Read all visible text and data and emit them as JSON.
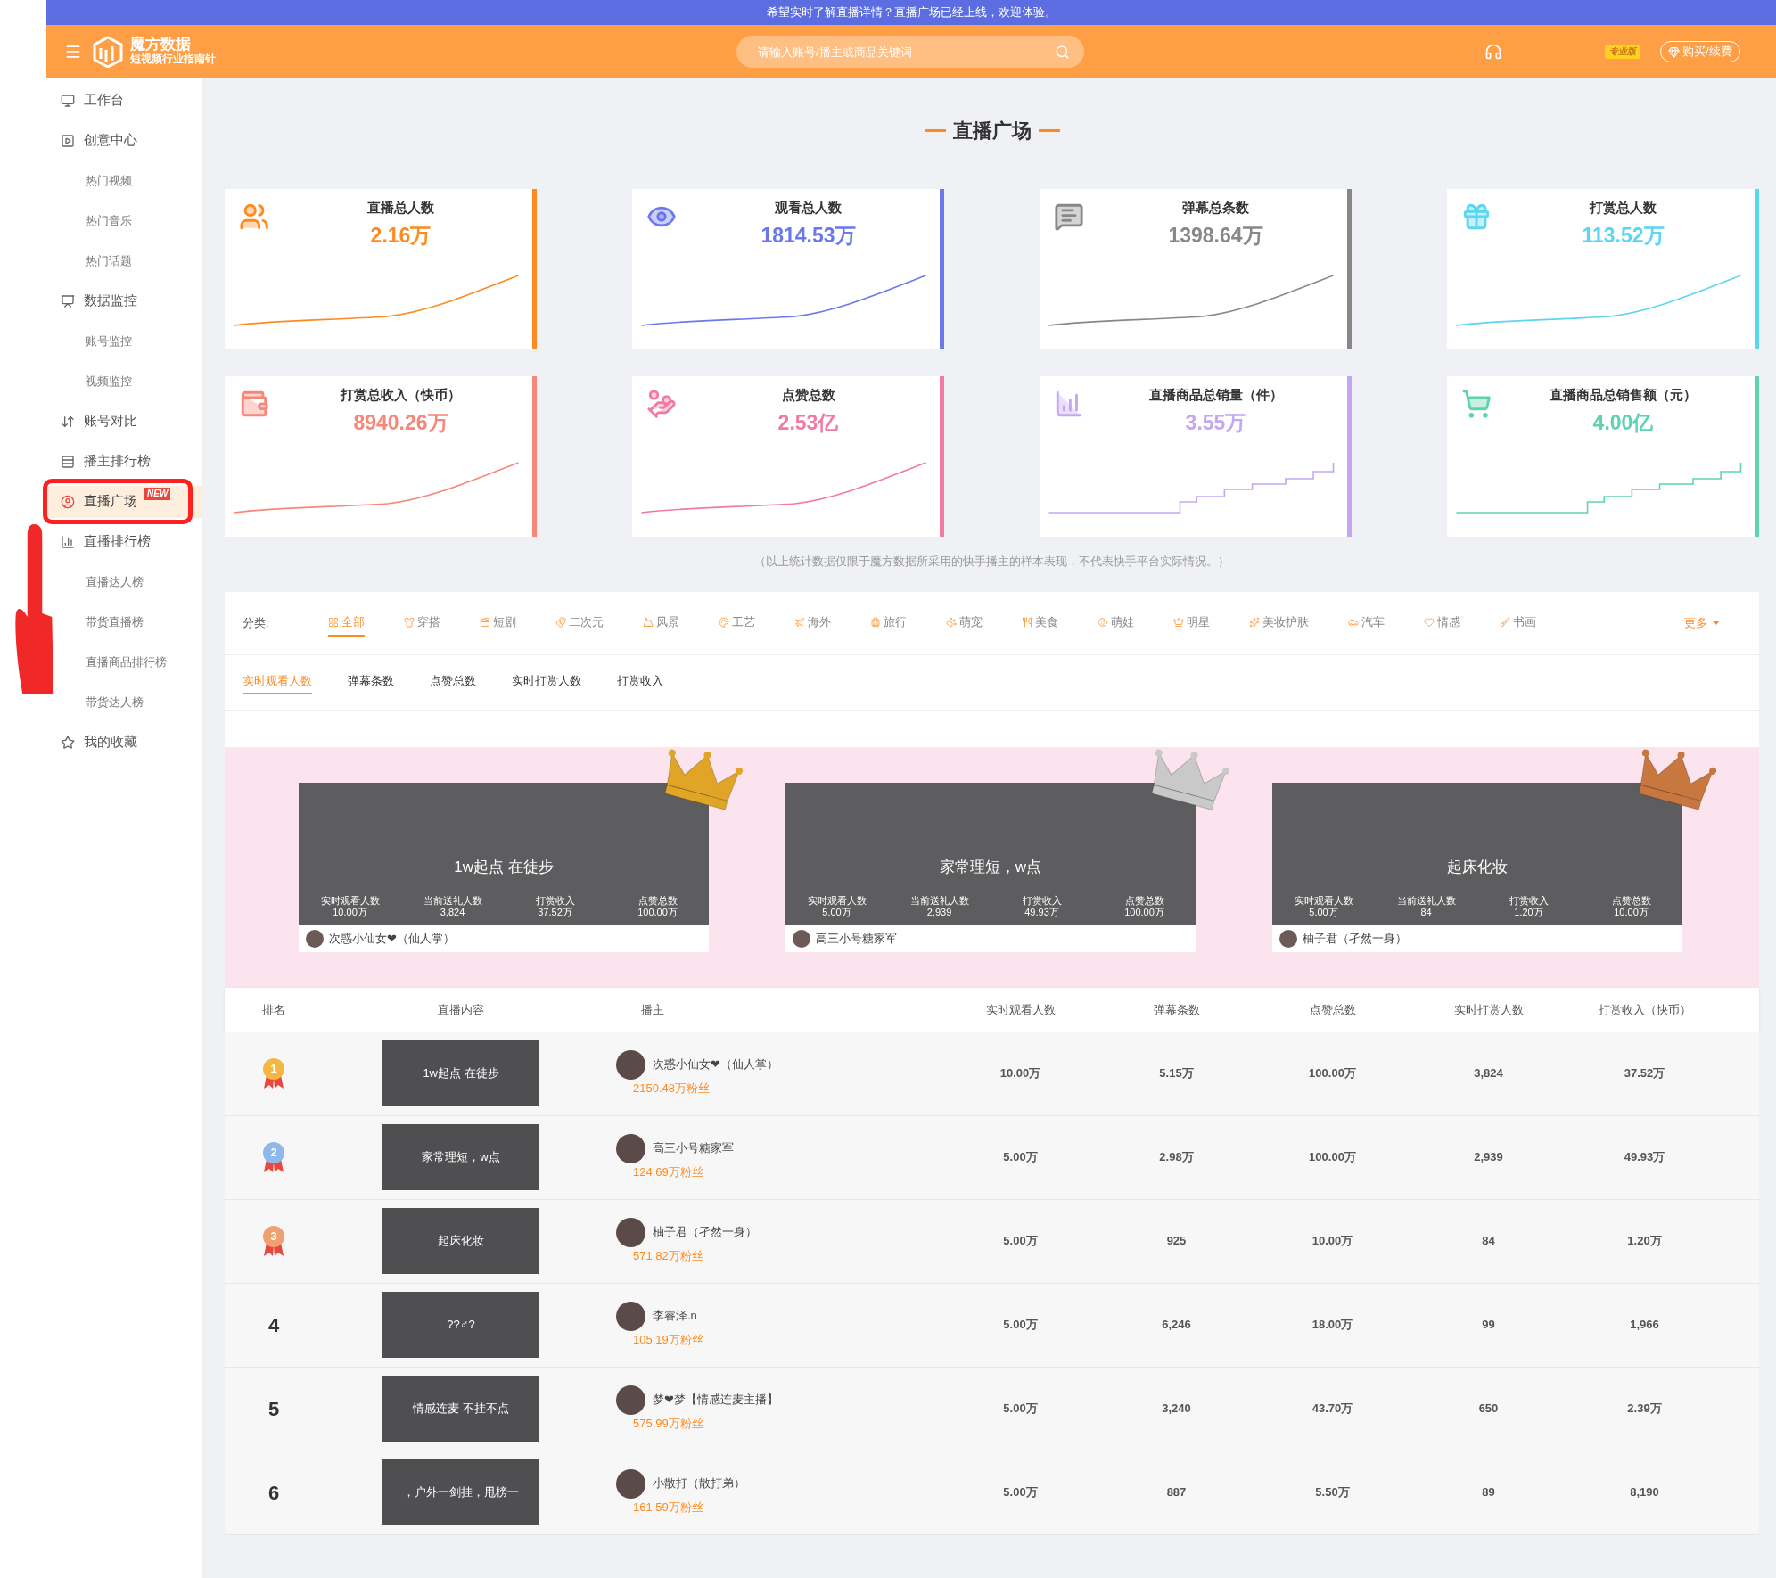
{
  "banner": {
    "text": "希望实时了解直播详情？直播广场已经上线，欢迎体验。"
  },
  "header": {
    "brand": "魔方数据",
    "tagline": "短视频行业指南针",
    "search": {
      "placeholder": "请输入账号/播主或商品关键词"
    },
    "plan_badge": "专业版",
    "buy_button": "购买/续费"
  },
  "sidebar": {
    "items": [
      {
        "label": "工作台",
        "selected": false
      },
      {
        "label": "创意中心",
        "selected": false,
        "children": [
          {
            "label": "热门视频",
            "selected": false
          },
          {
            "label": "热门音乐",
            "selected": false
          },
          {
            "label": "热门话题",
            "selected": false
          }
        ]
      },
      {
        "label": "数据监控",
        "selected": false,
        "children": [
          {
            "label": "账号监控",
            "selected": false
          },
          {
            "label": "视频监控",
            "selected": false
          }
        ]
      },
      {
        "label": "账号对比",
        "selected": false
      },
      {
        "label": "播主排行榜",
        "selected": false
      },
      {
        "label": "直播广场",
        "selected": true,
        "badge": "NEW"
      },
      {
        "label": "直播排行榜",
        "selected": false,
        "children": [
          {
            "label": "直播达人榜",
            "selected": false
          },
          {
            "label": "带货直播榜",
            "selected": false
          },
          {
            "label": "直播商品排行榜",
            "selected": false
          },
          {
            "label": "带货达人榜",
            "selected": false
          }
        ]
      },
      {
        "label": "我的收藏",
        "selected": false
      }
    ]
  },
  "page_title": "直播广场",
  "stat_cards": [
    {
      "title": "直播总人数",
      "value": "2.16万",
      "color": "#ff8a1f",
      "kind": "curve"
    },
    {
      "title": "观看总人数",
      "value": "1814.53万",
      "color": "#6b78ec",
      "kind": "curve"
    },
    {
      "title": "弹幕总条数",
      "value": "1398.64万",
      "color": "#888888",
      "kind": "curve"
    },
    {
      "title": "打赏总人数",
      "value": "113.52万",
      "color": "#5ad6f0",
      "kind": "curve"
    },
    {
      "title": "打赏总收入（快币）",
      "value": "8940.26万",
      "color": "#f7877a",
      "kind": "curve"
    },
    {
      "title": "点赞总数",
      "value": "2.53亿",
      "color": "#f27aa2",
      "kind": "curve"
    },
    {
      "title": "直播商品总销量（件）",
      "value": "3.55万",
      "color": "#c3a6f4",
      "kind": "step"
    },
    {
      "title": "直播商品总销售额（元）",
      "value": "4.00亿",
      "color": "#5fd3b0",
      "kind": "step"
    }
  ],
  "note": "（以上统计数据仅限于魔方数据所采用的快手播主的样本表现，不代表快手平台实际情况。）",
  "categories": {
    "label": "分类:",
    "more": "更多",
    "items": [
      {
        "label": "全部",
        "selected": true
      },
      {
        "label": "穿搭",
        "selected": false
      },
      {
        "label": "短剧",
        "selected": false
      },
      {
        "label": "二次元",
        "selected": false
      },
      {
        "label": "风景",
        "selected": false
      },
      {
        "label": "工艺",
        "selected": false
      },
      {
        "label": "海外",
        "selected": false
      },
      {
        "label": "旅行",
        "selected": false
      },
      {
        "label": "萌宠",
        "selected": false
      },
      {
        "label": "美食",
        "selected": false
      },
      {
        "label": "萌娃",
        "selected": false
      },
      {
        "label": "明星",
        "selected": false
      },
      {
        "label": "美妆护肤",
        "selected": false
      },
      {
        "label": "汽车",
        "selected": false
      },
      {
        "label": "情感",
        "selected": false
      },
      {
        "label": "书画",
        "selected": false
      }
    ]
  },
  "metric_tabs": [
    {
      "label": "实时观看人数",
      "selected": true
    },
    {
      "label": "弹幕条数",
      "selected": false
    },
    {
      "label": "点赞总数",
      "selected": false
    },
    {
      "label": "实时打赏人数",
      "selected": false
    },
    {
      "label": "打赏收入",
      "selected": false
    }
  ],
  "podium": [
    {
      "title": "1w起点 在徒步",
      "color": "#e0a526",
      "anchor": "次惑小仙女❤（仙人掌）",
      "stats": [
        {
          "label": "实时观看人数",
          "value": "10.00万"
        },
        {
          "label": "当前送礼人数",
          "value": "3,824"
        },
        {
          "label": "打赏收入",
          "value": "37.52万"
        },
        {
          "label": "点赞总数",
          "value": "100.00万"
        }
      ]
    },
    {
      "title": "家常理短，w点",
      "color": "#c9c9c9",
      "anchor": "高三小号糖家军",
      "stats": [
        {
          "label": "实时观看人数",
          "value": "5.00万"
        },
        {
          "label": "当前送礼人数",
          "value": "2,939"
        },
        {
          "label": "打赏收入",
          "value": "49.93万"
        },
        {
          "label": "点赞总数",
          "value": "100.00万"
        }
      ]
    },
    {
      "title": "起床化妆",
      "color": "#c8773f",
      "anchor": "柚子君（孑然一身）",
      "stats": [
        {
          "label": "实时观看人数",
          "value": "5.00万"
        },
        {
          "label": "当前送礼人数",
          "value": "84"
        },
        {
          "label": "打赏收入",
          "value": "1.20万"
        },
        {
          "label": "点赞总数",
          "value": "10.00万"
        }
      ]
    }
  ],
  "table": {
    "columns": [
      "排名",
      "直播内容",
      "播主",
      "实时观看人数",
      "弹幕条数",
      "点赞总数",
      "实时打赏人数",
      "打赏收入（快币）"
    ],
    "rows": [
      {
        "kind": "medal",
        "color": "#f5b642",
        "cells": [
          "1",
          "1w起点 在徒步",
          {
            "name": "次惑小仙女❤（仙人掌）",
            "fans": "2150.48万粉丝"
          },
          "10.00万",
          "5.15万",
          "100.00万",
          "3,824",
          "37.52万"
        ]
      },
      {
        "kind": "medal",
        "color": "#8fb8ea",
        "cells": [
          "2",
          "家常理短，w点",
          {
            "name": "高三小号糖家军",
            "fans": "124.69万粉丝"
          },
          "5.00万",
          "2.98万",
          "100.00万",
          "2,939",
          "49.93万"
        ]
      },
      {
        "kind": "medal",
        "color": "#f0a070",
        "cells": [
          "3",
          "起床化妆",
          {
            "name": "柚子君（孑然一身）",
            "fans": "571.82万粉丝"
          },
          "5.00万",
          "925",
          "10.00万",
          "84",
          "1.20万"
        ]
      },
      {
        "kind": "number",
        "cells": [
          "4",
          "??♂?",
          {
            "name": "李睿泽.n",
            "fans": "105.19万粉丝"
          },
          "5.00万",
          "6,246",
          "18.00万",
          "99",
          "1,966"
        ]
      },
      {
        "kind": "number",
        "cells": [
          "5",
          "情感连麦 不挂不点",
          {
            "name": "梦❤梦【情感连麦主播】",
            "fans": "575.99万粉丝"
          },
          "5.00万",
          "3,240",
          "43.70万",
          "650",
          "2.39万"
        ]
      },
      {
        "kind": "number",
        "cells": [
          "6",
          "，户外一剑挂，甩榜一",
          {
            "name": "小散打（散打弟）",
            "fans": "161.59万粉丝"
          },
          "5.00万",
          "887",
          "5.50万",
          "89",
          "8,190"
        ]
      }
    ]
  }
}
